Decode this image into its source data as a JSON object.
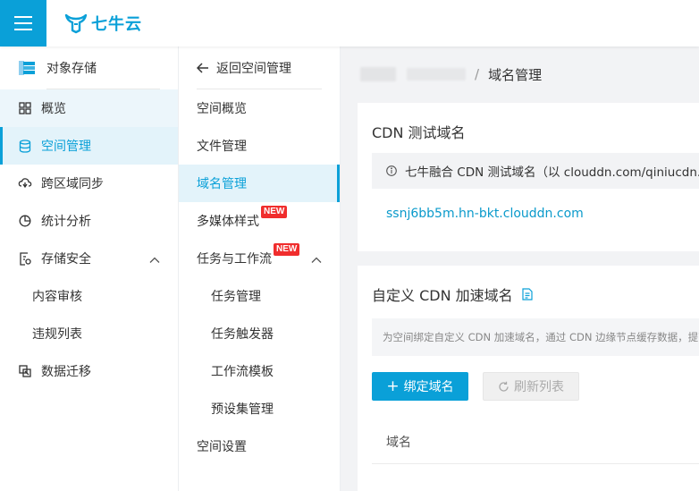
{
  "header": {
    "logo_text": "七牛云"
  },
  "sidebar": {
    "title": "对象存储",
    "items": [
      {
        "label": "概览"
      },
      {
        "label": "空间管理"
      },
      {
        "label": "跨区域同步"
      },
      {
        "label": "统计分析"
      },
      {
        "label": "存储安全"
      },
      {
        "label": "内容审核"
      },
      {
        "label": "违规列表"
      },
      {
        "label": "数据迁移"
      }
    ]
  },
  "subnav": {
    "back_label": "返回空间管理",
    "items": [
      {
        "label": "空间概览"
      },
      {
        "label": "文件管理"
      },
      {
        "label": "域名管理"
      },
      {
        "label": "多媒体样式",
        "badge": "NEW"
      },
      {
        "label": "任务与工作流",
        "badge": "NEW"
      },
      {
        "label": "任务管理"
      },
      {
        "label": "任务触发器"
      },
      {
        "label": "工作流模板"
      },
      {
        "label": "预设集管理"
      },
      {
        "label": "空间设置"
      }
    ]
  },
  "breadcrumb": {
    "separator": "/",
    "current": "域名管理"
  },
  "test_domain_card": {
    "title": "CDN 测试域名",
    "info": "七牛融合 CDN 测试域名（以 clouddn.com/qiniucdn.com/qiniudn.com 等结尾）",
    "domain": "ssnj6bb5m.hn-bkt.clouddn.com"
  },
  "custom_domain_card": {
    "title": "自定义 CDN 加速域名",
    "description": "为空间绑定自定义 CDN 加速域名，通过 CDN 边缘节点缓存数据，提高用户访问速度",
    "bind_button": "绑定域名",
    "refresh_button": "刷新列表",
    "table_header": "域名"
  },
  "colors": {
    "accent": "#0aa0d8",
    "badge": "#f02d2d"
  }
}
